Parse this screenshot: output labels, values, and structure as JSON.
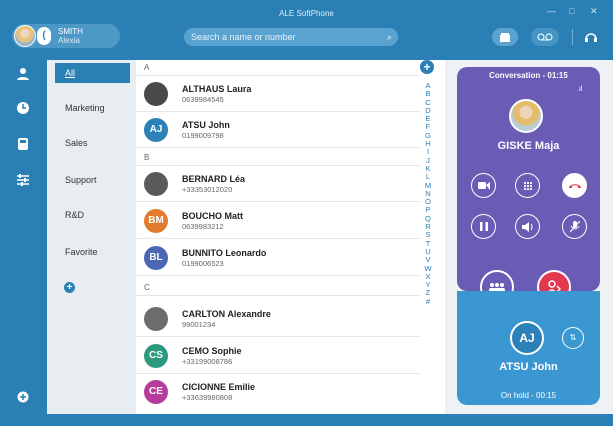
{
  "app": {
    "title": "ALE SoftPhone"
  },
  "user": {
    "last_name": "SMITH",
    "first_name": "Alexia"
  },
  "search": {
    "placeholder": "Search a name or number"
  },
  "groups": [
    {
      "label": "All",
      "active": true
    },
    {
      "label": "Marketing"
    },
    {
      "label": "Sales"
    },
    {
      "label": "Support"
    },
    {
      "label": "R&D"
    },
    {
      "label": "Favorite"
    }
  ],
  "sections": [
    "A",
    "B",
    "C"
  ],
  "contacts": [
    {
      "name": "ALTHAUS Laura",
      "number": "0639984545",
      "initials": "",
      "color": "#444"
    },
    {
      "name": "ATSU John",
      "number": "0199009798",
      "initials": "AJ",
      "color": "#2c81b9"
    },
    {
      "name": "BERNARD Léa",
      "number": "+33353012020",
      "initials": "",
      "color": "#555"
    },
    {
      "name": "BOUCHO Matt",
      "number": "0639983212",
      "initials": "BM",
      "color": "#e27b2e"
    },
    {
      "name": "BUNNITO Leonardo",
      "number": "0199006523",
      "initials": "BL",
      "color": "#4a67b5"
    },
    {
      "name": "CARLTON Alexandre",
      "number": "99001234",
      "initials": "",
      "color": "#666"
    },
    {
      "name": "CEMO Sophie",
      "number": "+33199008786",
      "initials": "CS",
      "color": "#2b9a7e"
    },
    {
      "name": "CICIONNE Emilie",
      "number": "+33639980808",
      "initials": "CE",
      "color": "#b73b9b"
    }
  ],
  "alphabet": [
    "A",
    "B",
    "C",
    "D",
    "E",
    "F",
    "G",
    "H",
    "I",
    "J",
    "K",
    "L",
    "M",
    "N",
    "O",
    "P",
    "Q",
    "R",
    "S",
    "T",
    "U",
    "V",
    "W",
    "X",
    "Y",
    "Z",
    "#"
  ],
  "conversation": {
    "title": "Conversation - 01:15",
    "remote_name": "GISKE Maja"
  },
  "on_hold": {
    "initials": "AJ",
    "name": "ATSU John",
    "status": "On hold - 00:15"
  },
  "colors": {
    "primary": "#2a7fb5",
    "conversation": "#6a5bb4",
    "hangup": "#e13a4f",
    "hold_panel": "#3b97d1"
  }
}
